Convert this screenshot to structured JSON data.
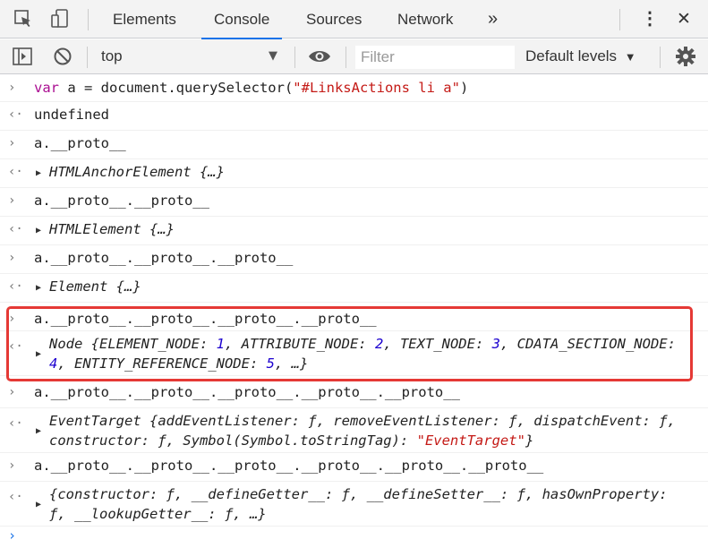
{
  "tabs": [
    {
      "label": "Elements"
    },
    {
      "label": "Console"
    },
    {
      "label": "Sources"
    },
    {
      "label": "Network"
    }
  ],
  "more_tabs": "»",
  "menu_glyph": "⋮",
  "close_glyph": "✕",
  "toolbar": {
    "context": "top",
    "filter_placeholder": "Filter",
    "levels": "Default levels",
    "levels_arrow": "▼"
  },
  "console": {
    "entries": [
      {
        "kind": "input",
        "parts": [
          {
            "t": "var",
            "c": "kw"
          },
          {
            "t": " a = document.querySelector("
          },
          {
            "t": "\"#LinksActions li a\"",
            "c": "str"
          },
          {
            "t": ")"
          }
        ]
      },
      {
        "kind": "result",
        "text": "undefined",
        "style": "undef"
      },
      {
        "kind": "input",
        "text": "a.__proto__"
      },
      {
        "kind": "object",
        "text": "HTMLAnchorElement {…}"
      },
      {
        "kind": "input",
        "text": "a.__proto__.__proto__"
      },
      {
        "kind": "object",
        "text": "HTMLElement {…}"
      },
      {
        "kind": "input",
        "text": "a.__proto__.__proto__.__proto__"
      },
      {
        "kind": "object",
        "text": "Element {…}"
      },
      {
        "kind": "input",
        "text": "a.__proto__.__proto__.__proto__.__proto__"
      },
      {
        "kind": "object_long",
        "parts": [
          {
            "t": "Node {ELEMENT_NODE: "
          },
          {
            "t": "1",
            "c": "num"
          },
          {
            "t": ", ATTRIBUTE_NODE: "
          },
          {
            "t": "2",
            "c": "num"
          },
          {
            "t": ", TEXT_NODE: "
          },
          {
            "t": "3",
            "c": "num"
          },
          {
            "t": ", CDATA_SECTION_NODE: "
          },
          {
            "t": "4",
            "c": "num"
          },
          {
            "t": ", ENTITY_REFERENCE_NODE: "
          },
          {
            "t": "5",
            "c": "num"
          },
          {
            "t": ", …}"
          }
        ]
      },
      {
        "kind": "input",
        "text": "a.__proto__.__proto__.__proto__.__proto__.__proto__"
      },
      {
        "kind": "object_long",
        "parts": [
          {
            "t": "EventTarget {addEventListener: ƒ, removeEventListener: ƒ, dispatchEvent: ƒ, constructor: ƒ, Symbol(Symbol.toStringTag): "
          },
          {
            "t": "\"EventTarget\"",
            "c": "strit"
          },
          {
            "t": "}"
          }
        ]
      },
      {
        "kind": "input",
        "text": "a.__proto__.__proto__.__proto__.__proto__.__proto__.__proto__"
      },
      {
        "kind": "object_long",
        "parts": [
          {
            "t": "{constructor: ƒ, __defineGetter__: ƒ, __defineSetter__: ƒ, hasOwnProperty: ƒ, __lookupGetter__: ƒ, …}"
          }
        ]
      }
    ]
  },
  "glyphs": {
    "input_prompt": "›",
    "result_prompt": "‹·",
    "expand": "▶",
    "caret": "›"
  }
}
